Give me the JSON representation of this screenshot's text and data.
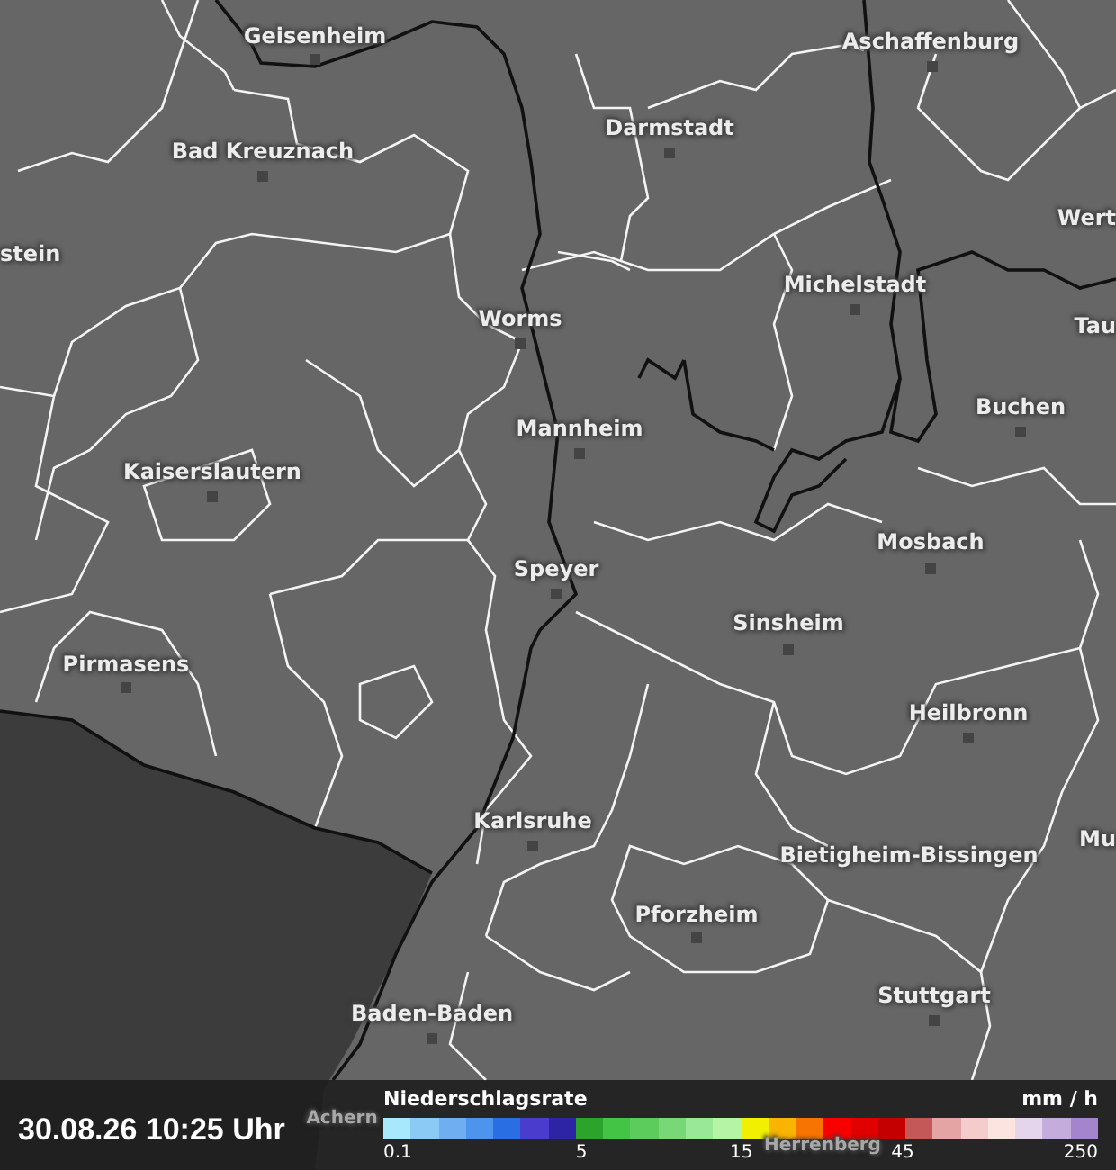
{
  "map": {
    "cities": [
      {
        "name": "Geisenheim",
        "marker": true
      },
      {
        "name": "Aschaffenburg",
        "marker": true
      },
      {
        "name": "Darmstadt",
        "marker": true
      },
      {
        "name": "Bad Kreuznach",
        "marker": true
      },
      {
        "name": "Wert",
        "marker": false
      },
      {
        "name": "stein",
        "marker": false
      },
      {
        "name": "Michelstadt",
        "marker": true
      },
      {
        "name": "Worms",
        "marker": true
      },
      {
        "name": "Tau",
        "marker": false
      },
      {
        "name": "Buchen",
        "marker": true
      },
      {
        "name": "Mannheim",
        "marker": true
      },
      {
        "name": "Kaiserslautern",
        "marker": true
      },
      {
        "name": "Mosbach",
        "marker": true
      },
      {
        "name": "Speyer",
        "marker": true
      },
      {
        "name": "Sinsheim",
        "marker": true
      },
      {
        "name": "Pirmasens",
        "marker": true
      },
      {
        "name": "Heilbronn",
        "marker": true
      },
      {
        "name": "Karlsruhe",
        "marker": true
      },
      {
        "name": "Mu",
        "marker": false
      },
      {
        "name": "Bietigheim-Bissingen",
        "marker": false
      },
      {
        "name": "Pforzheim",
        "marker": true
      },
      {
        "name": "Stuttgart",
        "marker": true
      },
      {
        "name": "Baden-Baden",
        "marker": true
      },
      {
        "name": "Achern",
        "marker": false
      },
      {
        "name": "Herrenberg",
        "marker": false
      }
    ]
  },
  "footer": {
    "timestamp": "30.08.26 10:25 Uhr",
    "legend": {
      "title": "Niederschlagsrate",
      "unit": "mm / h",
      "swatches": [
        {
          "color": "#a8e8fc"
        },
        {
          "color": "#8ccaf6"
        },
        {
          "color": "#70aef2"
        },
        {
          "color": "#4c94ec"
        },
        {
          "color": "#2a6ee4"
        },
        {
          "color": "#4a3ccc"
        },
        {
          "color": "#2c24a4"
        },
        {
          "color": "#2ca42c"
        },
        {
          "color": "#44c444"
        },
        {
          "color": "#5ccc5c"
        },
        {
          "color": "#78d878"
        },
        {
          "color": "#98e898"
        },
        {
          "color": "#b4f4a4"
        },
        {
          "color": "#f0f000"
        },
        {
          "color": "#f8b400"
        },
        {
          "color": "#f87400"
        },
        {
          "color": "#f80000"
        },
        {
          "color": "#e00000"
        },
        {
          "color": "#c40000"
        },
        {
          "color": "#c45858"
        },
        {
          "color": "#e4a4a4"
        },
        {
          "color": "#f4cccc"
        },
        {
          "color": "#fce4e0"
        },
        {
          "color": "#e4d4ec"
        },
        {
          "color": "#c4acdc"
        },
        {
          "color": "#a484cc"
        }
      ],
      "ticks": [
        {
          "label": "0.1"
        },
        {
          "label": "5"
        },
        {
          "label": "15"
        },
        {
          "label": "45"
        },
        {
          "label": "250"
        }
      ]
    }
  }
}
